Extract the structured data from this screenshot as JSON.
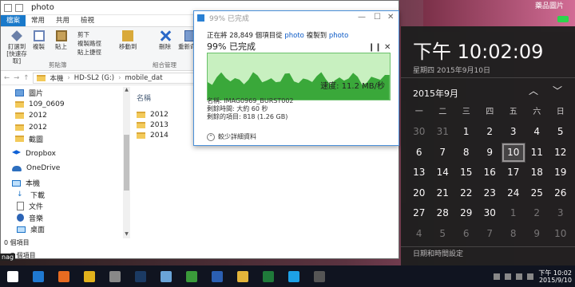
{
  "explorer": {
    "title": "photo",
    "tabs": [
      "檔案",
      "常用",
      "共用",
      "檢視"
    ],
    "ribbon": {
      "pin_label": "釘選到 [快速存取]",
      "copy_label": "複製",
      "paste_label": "貼上",
      "small": [
        "剪下",
        "複製路徑",
        "貼上捷徑"
      ],
      "clipboard_group": "剪貼簿",
      "move_label": "移動到",
      "delete_label": "刪除",
      "rename_label": "重新命名",
      "organize_group": "組合管理"
    },
    "address": {
      "items": [
        "本機",
        "HD-SL2 (G:)",
        "mobile_dat"
      ]
    },
    "nav": [
      {
        "label": "圖片",
        "icon": "picture-icon"
      },
      {
        "label": "109_0609",
        "icon": "folder-icon"
      },
      {
        "label": "2012",
        "icon": "folder-icon"
      },
      {
        "label": "2012",
        "icon": "folder-icon"
      },
      {
        "label": "截圖",
        "icon": "folder-icon"
      },
      {
        "label": "Dropbox",
        "icon": "dropbox-icon"
      },
      {
        "label": "OneDrive",
        "icon": "onedrive-icon"
      },
      {
        "label": "本機",
        "icon": "pc-icon"
      },
      {
        "label": "下載",
        "icon": "download-icon"
      },
      {
        "label": "文件",
        "icon": "document-icon"
      },
      {
        "label": "音樂",
        "icon": "music-icon"
      },
      {
        "label": "桌面",
        "icon": "desktop-icon"
      }
    ],
    "column_header": "名稱",
    "files": [
      "2012",
      "2013",
      "2014"
    ],
    "status_top": "0 個項目",
    "status_bottom": "7 個項目"
  },
  "dialog": {
    "title": "99% 已完成",
    "copying_prefix": "正在將 28,849 個項目從",
    "source": "photo",
    "copy_to": "複製到",
    "dest": "photo",
    "progress_text": "99% 已完成",
    "progress": 0.99,
    "speed": "速度: 11.2 MB/秒",
    "name_line": "名稱: IMAG0969_BURST002",
    "time_line": "剩餘時間: 大約 60 秒",
    "items_line": "剩餘的項目: 818 (1.26 GB)",
    "less_details": "較少詳細資料",
    "graph_color": "#3aa83a"
  },
  "clock": {
    "time": "下午 10:02:09",
    "date_line": "星期四 2015年9月10日",
    "month": "2015年9月",
    "weekdays": [
      "一",
      "二",
      "三",
      "四",
      "五",
      "六",
      "日"
    ],
    "days": [
      {
        "d": "30",
        "dim": true
      },
      {
        "d": "31",
        "dim": true
      },
      {
        "d": "1"
      },
      {
        "d": "2"
      },
      {
        "d": "3"
      },
      {
        "d": "4"
      },
      {
        "d": "5"
      },
      {
        "d": "6"
      },
      {
        "d": "7"
      },
      {
        "d": "8"
      },
      {
        "d": "9"
      },
      {
        "d": "10",
        "today": true
      },
      {
        "d": "11"
      },
      {
        "d": "12"
      },
      {
        "d": "13"
      },
      {
        "d": "14"
      },
      {
        "d": "15"
      },
      {
        "d": "16"
      },
      {
        "d": "17"
      },
      {
        "d": "18"
      },
      {
        "d": "19"
      },
      {
        "d": "20"
      },
      {
        "d": "21"
      },
      {
        "d": "22"
      },
      {
        "d": "23"
      },
      {
        "d": "24"
      },
      {
        "d": "25"
      },
      {
        "d": "26"
      },
      {
        "d": "27"
      },
      {
        "d": "28"
      },
      {
        "d": "29"
      },
      {
        "d": "30"
      },
      {
        "d": "1",
        "dim": true
      },
      {
        "d": "2",
        "dim": true
      },
      {
        "d": "3",
        "dim": true
      },
      {
        "d": "4",
        "dim": true
      },
      {
        "d": "5",
        "dim": true
      },
      {
        "d": "6",
        "dim": true
      },
      {
        "d": "7",
        "dim": true
      },
      {
        "d": "8",
        "dim": true
      },
      {
        "d": "9",
        "dim": true
      },
      {
        "d": "10",
        "dim": true
      }
    ],
    "settings_link": "日期和時間設定"
  },
  "taskbar": {
    "apps": [
      {
        "name": "windows-icon",
        "color": "#ffffff"
      },
      {
        "name": "edge-icon",
        "color": "#1f79d1"
      },
      {
        "name": "firefox-icon",
        "color": "#e66b21"
      },
      {
        "name": "chrome-icon",
        "color": "#e2b21c"
      },
      {
        "name": "calculator-icon",
        "color": "#888888"
      },
      {
        "name": "photoshop-icon",
        "color": "#1b3a63"
      },
      {
        "name": "app-icon",
        "color": "#6aa4d8"
      },
      {
        "name": "media-icon",
        "color": "#3a9a3a"
      },
      {
        "name": "word-icon",
        "color": "#2b5fb2"
      },
      {
        "name": "file-explorer-icon",
        "color": "#e3b43a"
      },
      {
        "name": "excel-icon",
        "color": "#1f7a3a"
      },
      {
        "name": "skype-icon",
        "color": "#1da1e6"
      },
      {
        "name": "app2-icon",
        "color": "#555555"
      }
    ],
    "time": "下午 10:02",
    "date": "2015/9/10"
  },
  "desktop": {
    "top_right_text": "藥品圖片",
    "left_cut_text": "nag"
  }
}
